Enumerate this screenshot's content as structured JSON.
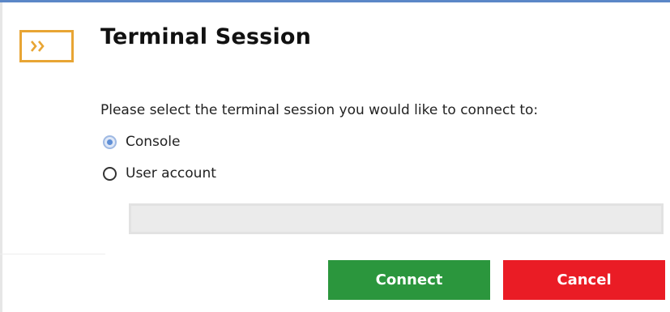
{
  "dialog": {
    "title": "Terminal Session",
    "prompt": "Please select the terminal session you would like to connect to:",
    "options": [
      {
        "label": "Console",
        "selected": true
      },
      {
        "label": "User account",
        "selected": false
      }
    ],
    "user_account_value": "",
    "connect_label": "Connect",
    "cancel_label": "Cancel"
  },
  "icons": {
    "app_icon": "terminal-icon"
  },
  "colors": {
    "accent_bar": "#5b87c7",
    "icon_border": "#e8a534",
    "connect": "#2b963d",
    "cancel": "#ea1c25",
    "radio_selected": "#5f8fd6"
  }
}
